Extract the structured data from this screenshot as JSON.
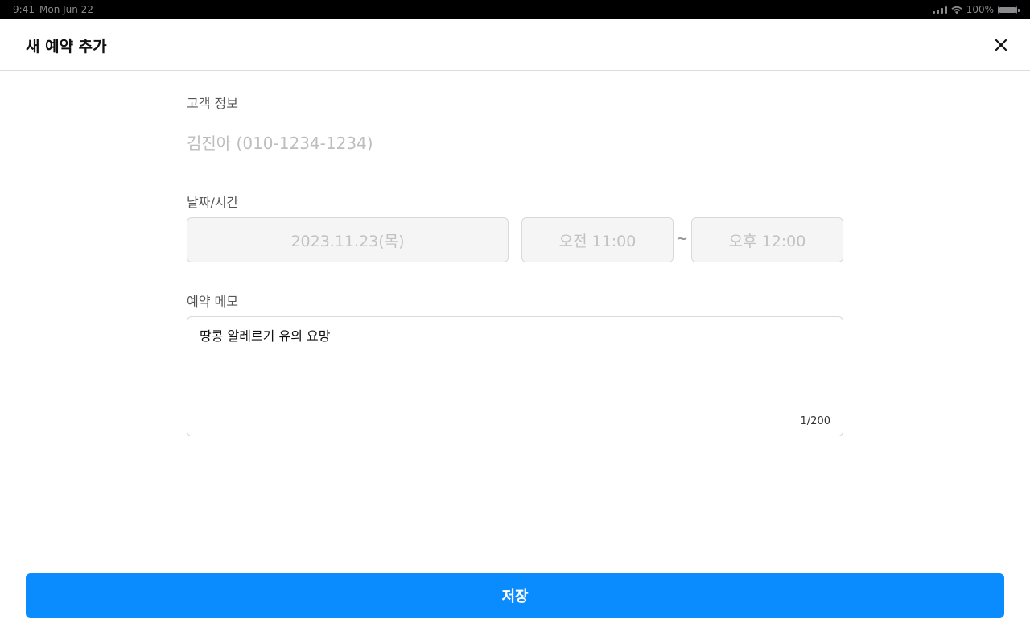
{
  "status_bar": {
    "time": "9:41",
    "date": "Mon Jun 22",
    "battery": "100%"
  },
  "header": {
    "title": "새 예약 추가",
    "close_icon": "close-icon"
  },
  "form": {
    "customer": {
      "label": "고객 정보",
      "value": "김진아 (010-1234-1234)"
    },
    "datetime": {
      "label": "날짜/시간",
      "date": "2023.11.23(목)",
      "start_time": "오전 11:00",
      "separator": "~",
      "end_time": "오후 12:00"
    },
    "memo": {
      "label": "예약 메모",
      "value": "땅콩 알레르기 유의 요망",
      "counter": "1/200"
    }
  },
  "footer": {
    "save_label": "저장"
  },
  "colors": {
    "accent": "#0a8cff",
    "disabled_text": "#c2c2c2",
    "field_bg": "#f5f5f5",
    "border": "#d9d9d9"
  }
}
